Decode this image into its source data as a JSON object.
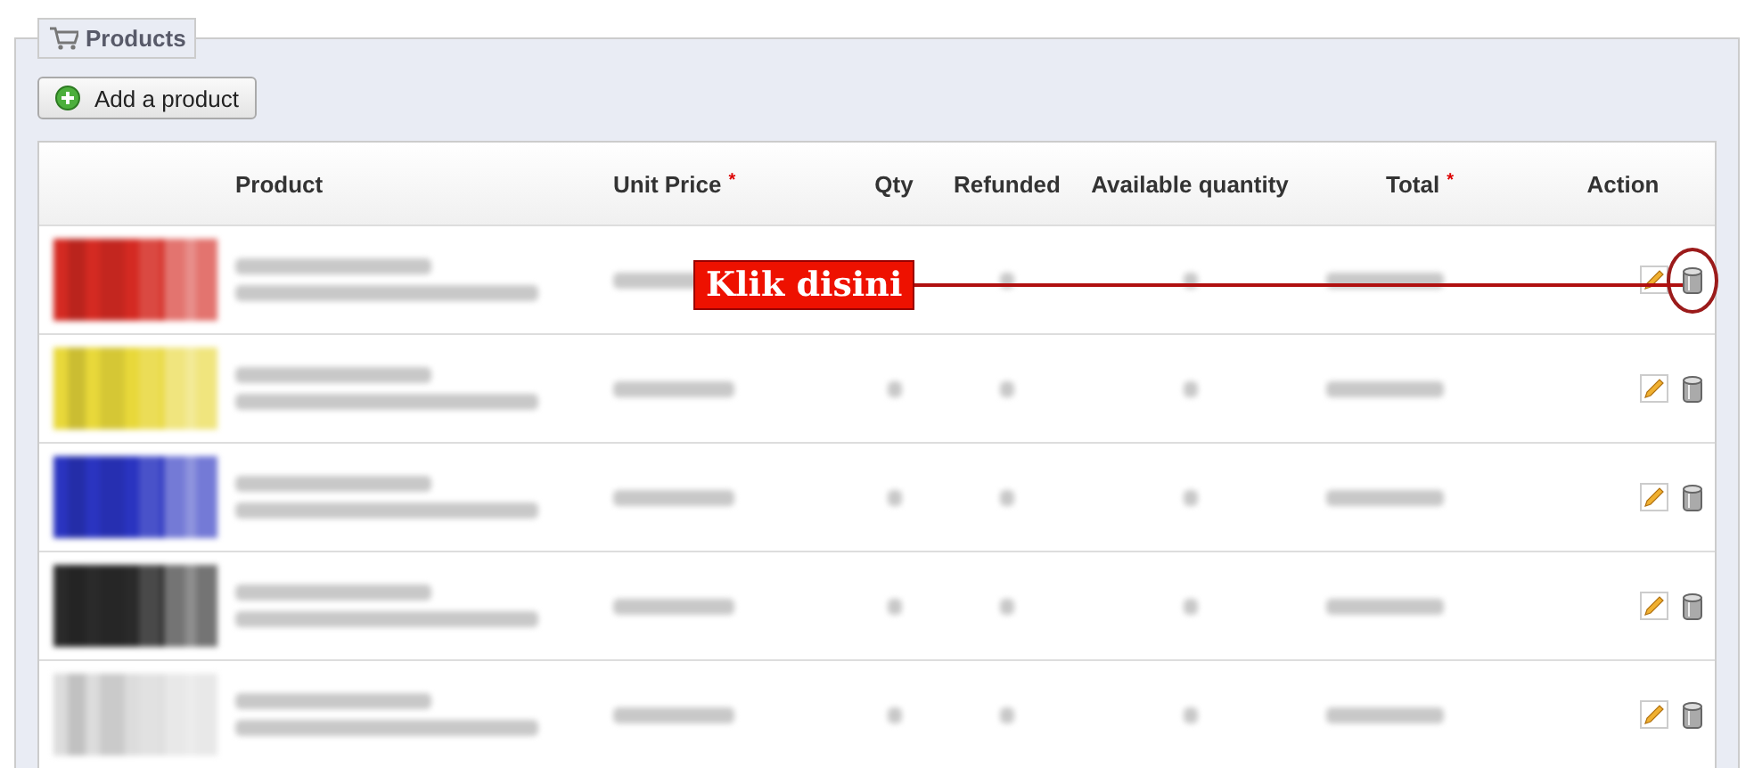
{
  "panel": {
    "title": "Products"
  },
  "add_button": {
    "label": "Add a product"
  },
  "table": {
    "columns": [
      {
        "label": "Product"
      },
      {
        "label": "Unit Price",
        "mark": "*"
      },
      {
        "label": "Qty"
      },
      {
        "label": "Refunded"
      },
      {
        "label": "Available quantity"
      },
      {
        "label": "Total",
        "mark": "*"
      },
      {
        "label": "Action"
      }
    ],
    "rows": [
      {
        "color": "#d42a22",
        "circled": true
      },
      {
        "color": "#e8d83a",
        "circled": false
      },
      {
        "color": "#2a34c0",
        "circled": false
      },
      {
        "color": "#2a2a2a",
        "circled": false
      },
      {
        "color": "#dcdcdc",
        "circled": false
      }
    ]
  },
  "annotation": {
    "label": "Klik disini"
  }
}
